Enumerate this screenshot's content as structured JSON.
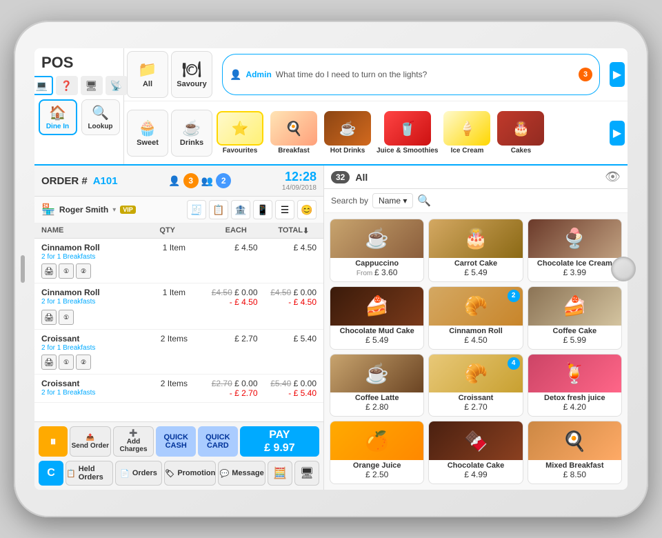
{
  "app": {
    "title": "POS"
  },
  "sidebar": {
    "icons": [
      "💻",
      "❓",
      "🖥",
      "📡"
    ],
    "buttons": [
      {
        "label": "Dine In",
        "icon": "🏠",
        "active": true
      },
      {
        "label": "Lookup",
        "icon": "🔍",
        "active": false
      }
    ]
  },
  "categories": [
    {
      "label": "All",
      "icon": "📁",
      "active": false
    },
    {
      "label": "Savoury",
      "icon": "🍽",
      "active": false
    }
  ],
  "categories2": [
    {
      "label": "Sweet",
      "icon": "🧁",
      "active": false
    },
    {
      "label": "Drinks",
      "icon": "☕",
      "active": false
    }
  ],
  "food_tabs": [
    {
      "label": "Favourites",
      "icon": "⭐",
      "active": true
    },
    {
      "label": "Breakfast",
      "emoji": "🍳"
    },
    {
      "label": "Hot Drinks",
      "emoji": "☕"
    },
    {
      "label": "Juice & Smoothies",
      "emoji": "🥤"
    },
    {
      "label": "Ice Cream",
      "emoji": "🍦"
    },
    {
      "label": "Cakes",
      "emoji": "🎂"
    }
  ],
  "chat": {
    "user": "Admin",
    "message": "What time do I need to turn on the lights?",
    "badge": "3"
  },
  "order": {
    "label": "ORDER #",
    "number": "A101",
    "badge_orange": "3",
    "badge_blue": "2",
    "time": "12:28",
    "date": "14/09/2018"
  },
  "customer": {
    "name": "Roger Smith",
    "vip": "VIP"
  },
  "table_headers": {
    "name": "NAME",
    "qty": "QTY",
    "each": "EACH",
    "total": "TOTAL"
  },
  "order_items": [
    {
      "name": "Cinnamon Roll",
      "sub": "2 for 1 Breakfasts",
      "qty": "1 Item",
      "each": "£ 4.50",
      "total": "£ 4.50",
      "strikethrough": false
    },
    {
      "name": "Cinnamon Roll",
      "sub": "2 for 1 Breakfasts",
      "qty": "1 Item",
      "each_strike": "£4.50",
      "each": "£ 0.00",
      "each_sub": "- £ 4.50",
      "total_strike": "£4.50",
      "total": "£ 0.00",
      "total_sub": "- £ 4.50",
      "strikethrough": true
    },
    {
      "name": "Croissant",
      "sub": "2 for 1 Breakfasts",
      "qty": "2 Items",
      "each": "£ 2.70",
      "total": "£ 5.40",
      "strikethrough": false
    },
    {
      "name": "Croissant",
      "sub": "2 for 1 Breakfasts",
      "qty": "2 Items",
      "each_strike": "£2.70",
      "each": "£ 0.00",
      "each_sub": "- £ 2.70",
      "total_strike": "£5.40",
      "total": "£ 0.00",
      "total_sub": "- £ 5.40",
      "strikethrough": true
    }
  ],
  "action_buttons": {
    "send_order": "Send Order",
    "add_charges": "Add Charges",
    "quick_cash": "QUICK CASH",
    "quick_card": "QUICK CARD",
    "pay": "PAY",
    "pay_amount": "£ 9.97",
    "held_orders": "Held Orders",
    "orders": "Orders",
    "promotion": "Promotion",
    "message": "Message"
  },
  "right_panel": {
    "count": "32",
    "all_label": "All",
    "search_label": "Search by",
    "search_value": "Name"
  },
  "products": [
    {
      "name": "Cappuccino",
      "price": "£ 3.60",
      "from": true,
      "img_class": "img-cappuccino",
      "emoji": "☕",
      "badge": null
    },
    {
      "name": "Carrot Cake",
      "price": "£ 5.49",
      "from": false,
      "img_class": "img-carrot",
      "emoji": "🎂",
      "badge": null
    },
    {
      "name": "Chocolate Ice Cream",
      "price": "£ 3.99",
      "from": false,
      "img_class": "img-choc-ice",
      "emoji": "🍨",
      "badge": null
    },
    {
      "name": "Chocolate Mud Cake",
      "price": "£ 5.49",
      "from": false,
      "img_class": "img-choc-mud",
      "emoji": "🍰",
      "badge": null
    },
    {
      "name": "Cinnamon Roll",
      "price": "£ 4.50",
      "from": false,
      "img_class": "img-cinnamon",
      "emoji": "🥐",
      "badge": "2"
    },
    {
      "name": "Coffee Cake",
      "price": "£ 5.99",
      "from": false,
      "img_class": "img-coffee-cake",
      "emoji": "🍰",
      "badge": null
    },
    {
      "name": "Coffee Latte",
      "price": "£ 2.80",
      "from": false,
      "img_class": "img-coffee-latte",
      "emoji": "☕",
      "badge": null
    },
    {
      "name": "Croissant",
      "price": "£ 2.70",
      "from": false,
      "img_class": "img-croissant",
      "emoji": "🥐",
      "badge": "4"
    },
    {
      "name": "Detox fresh juice",
      "price": "£ 4.20",
      "from": false,
      "img_class": "img-detox",
      "emoji": "🍹",
      "badge": null
    },
    {
      "name": "Orange Juice",
      "price": "£ 2.50",
      "from": false,
      "img_class": "img-orange",
      "emoji": "🍊",
      "badge": null
    },
    {
      "name": "Chocolate Cake",
      "price": "£ 4.99",
      "from": false,
      "img_class": "img-choc-cake2",
      "emoji": "🍫",
      "badge": null
    },
    {
      "name": "Mixed Breakfast",
      "price": "£ 8.50",
      "from": false,
      "img_class": "img-mixed",
      "emoji": "🍳",
      "badge": null
    }
  ]
}
